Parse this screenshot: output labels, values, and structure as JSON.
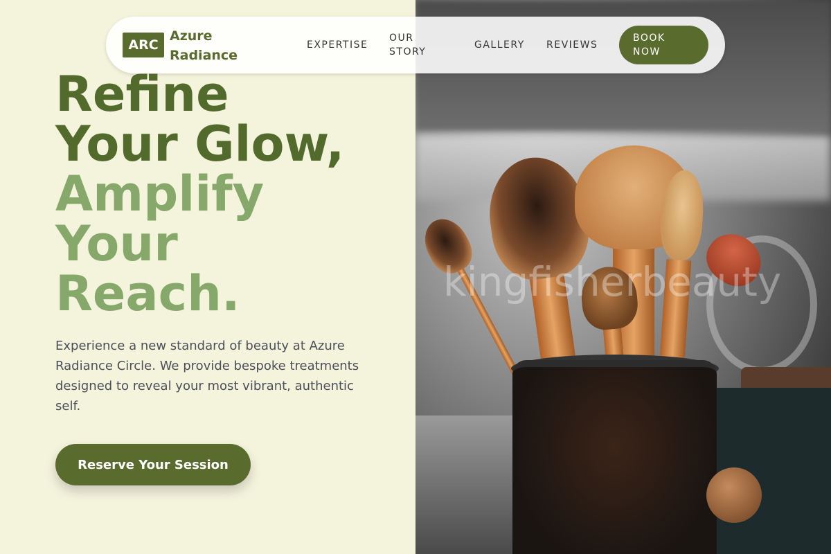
{
  "brand": {
    "logo_text": "ARC",
    "name": "Azure Radiance"
  },
  "nav": {
    "items": [
      {
        "label": "EXPERTISE"
      },
      {
        "label": "OUR STORY"
      },
      {
        "label": "GALLERY"
      },
      {
        "label": "REVIEWS"
      }
    ],
    "book_label": "BOOK NOW"
  },
  "hero": {
    "headline_dark": [
      "Refine",
      "Your Glow,"
    ],
    "headline_light": [
      "Amplify",
      "Your",
      "Reach."
    ],
    "description": "Experience a new standard of beauty at Azure Radiance Circle. We provide bespoke treatments designed to reveal your most vibrant, authentic self.",
    "cta_label": "Reserve Your Session"
  },
  "photo": {
    "watermark": "kingfisherbeauty",
    "subject": "makeup-brushes-in-cup"
  },
  "colors": {
    "primary": "#5a6b2e",
    "headline_dark": "#526a2c",
    "headline_light": "#86a86a",
    "background": "#f4f3dc"
  }
}
